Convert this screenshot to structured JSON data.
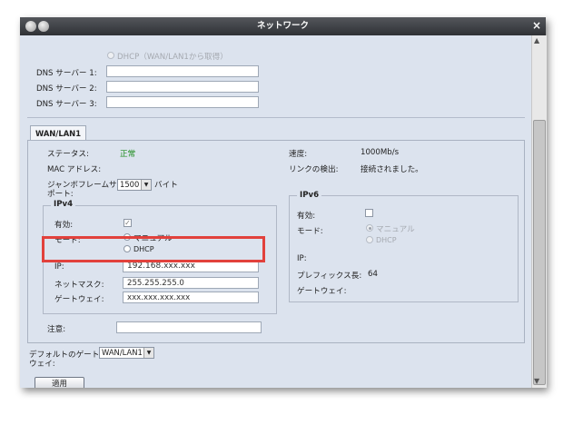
{
  "window": {
    "title": "ネットワーク",
    "close_glyph": "×"
  },
  "dns": {
    "dhcp_option": "DHCP（WAN/LAN1から取得）",
    "server1_label": "DNS サーバー 1:",
    "server2_label": "DNS サーバー 2:",
    "server3_label": "DNS サーバー 3:",
    "server1_value": "",
    "server2_value": "",
    "server3_value": ""
  },
  "tab": {
    "label": "WAN/LAN1"
  },
  "status": {
    "label": "ステータス:",
    "value": "正常",
    "value_color": "#1e8c1e",
    "mac_label": "MAC アドレス:",
    "jumbo_label_line1": "ジャンボフレームサ",
    "jumbo_label_line2": "ポート:",
    "jumbo_value": "1500",
    "jumbo_unit": "バイト",
    "speed_label": "速度:",
    "speed_value": "1000Mb/s",
    "link_label": "リンクの検出:",
    "link_value": "接続されました。"
  },
  "ipv4": {
    "title": "IPv4",
    "enabled_label": "有効:",
    "enabled_checked": true,
    "mode_label": "モード:",
    "mode_manual": "マニュアル",
    "mode_dhcp": "DHCP",
    "ip_label": "IP:",
    "ip_value": "192.168.xxx.xxx",
    "netmask_label": "ネットマスク:",
    "netmask_value": "255.255.255.0",
    "gateway_label": "ゲートウェイ:",
    "gateway_value": "xxx.xxx.xxx.xxx"
  },
  "ipv6": {
    "title": "IPv6",
    "enabled_label": "有効:",
    "enabled_checked": false,
    "mode_label": "モード:",
    "mode_manual": "マニュアル",
    "mode_dhcp": "DHCP",
    "ip_label": "IP:",
    "prefix_label": "プレフィックス長:",
    "prefix_value": "64",
    "gateway_label": "ゲートウェイ:"
  },
  "note": {
    "label": "注意:",
    "value": ""
  },
  "default_gateway": {
    "label_line1": "デフォルトのゲート",
    "label_line2": "ウェイ:",
    "value": "WAN/LAN1"
  },
  "apply_button": {
    "label": "適用"
  },
  "colors": {
    "highlight": "#e2413c",
    "window_bg": "#dce3ee"
  }
}
